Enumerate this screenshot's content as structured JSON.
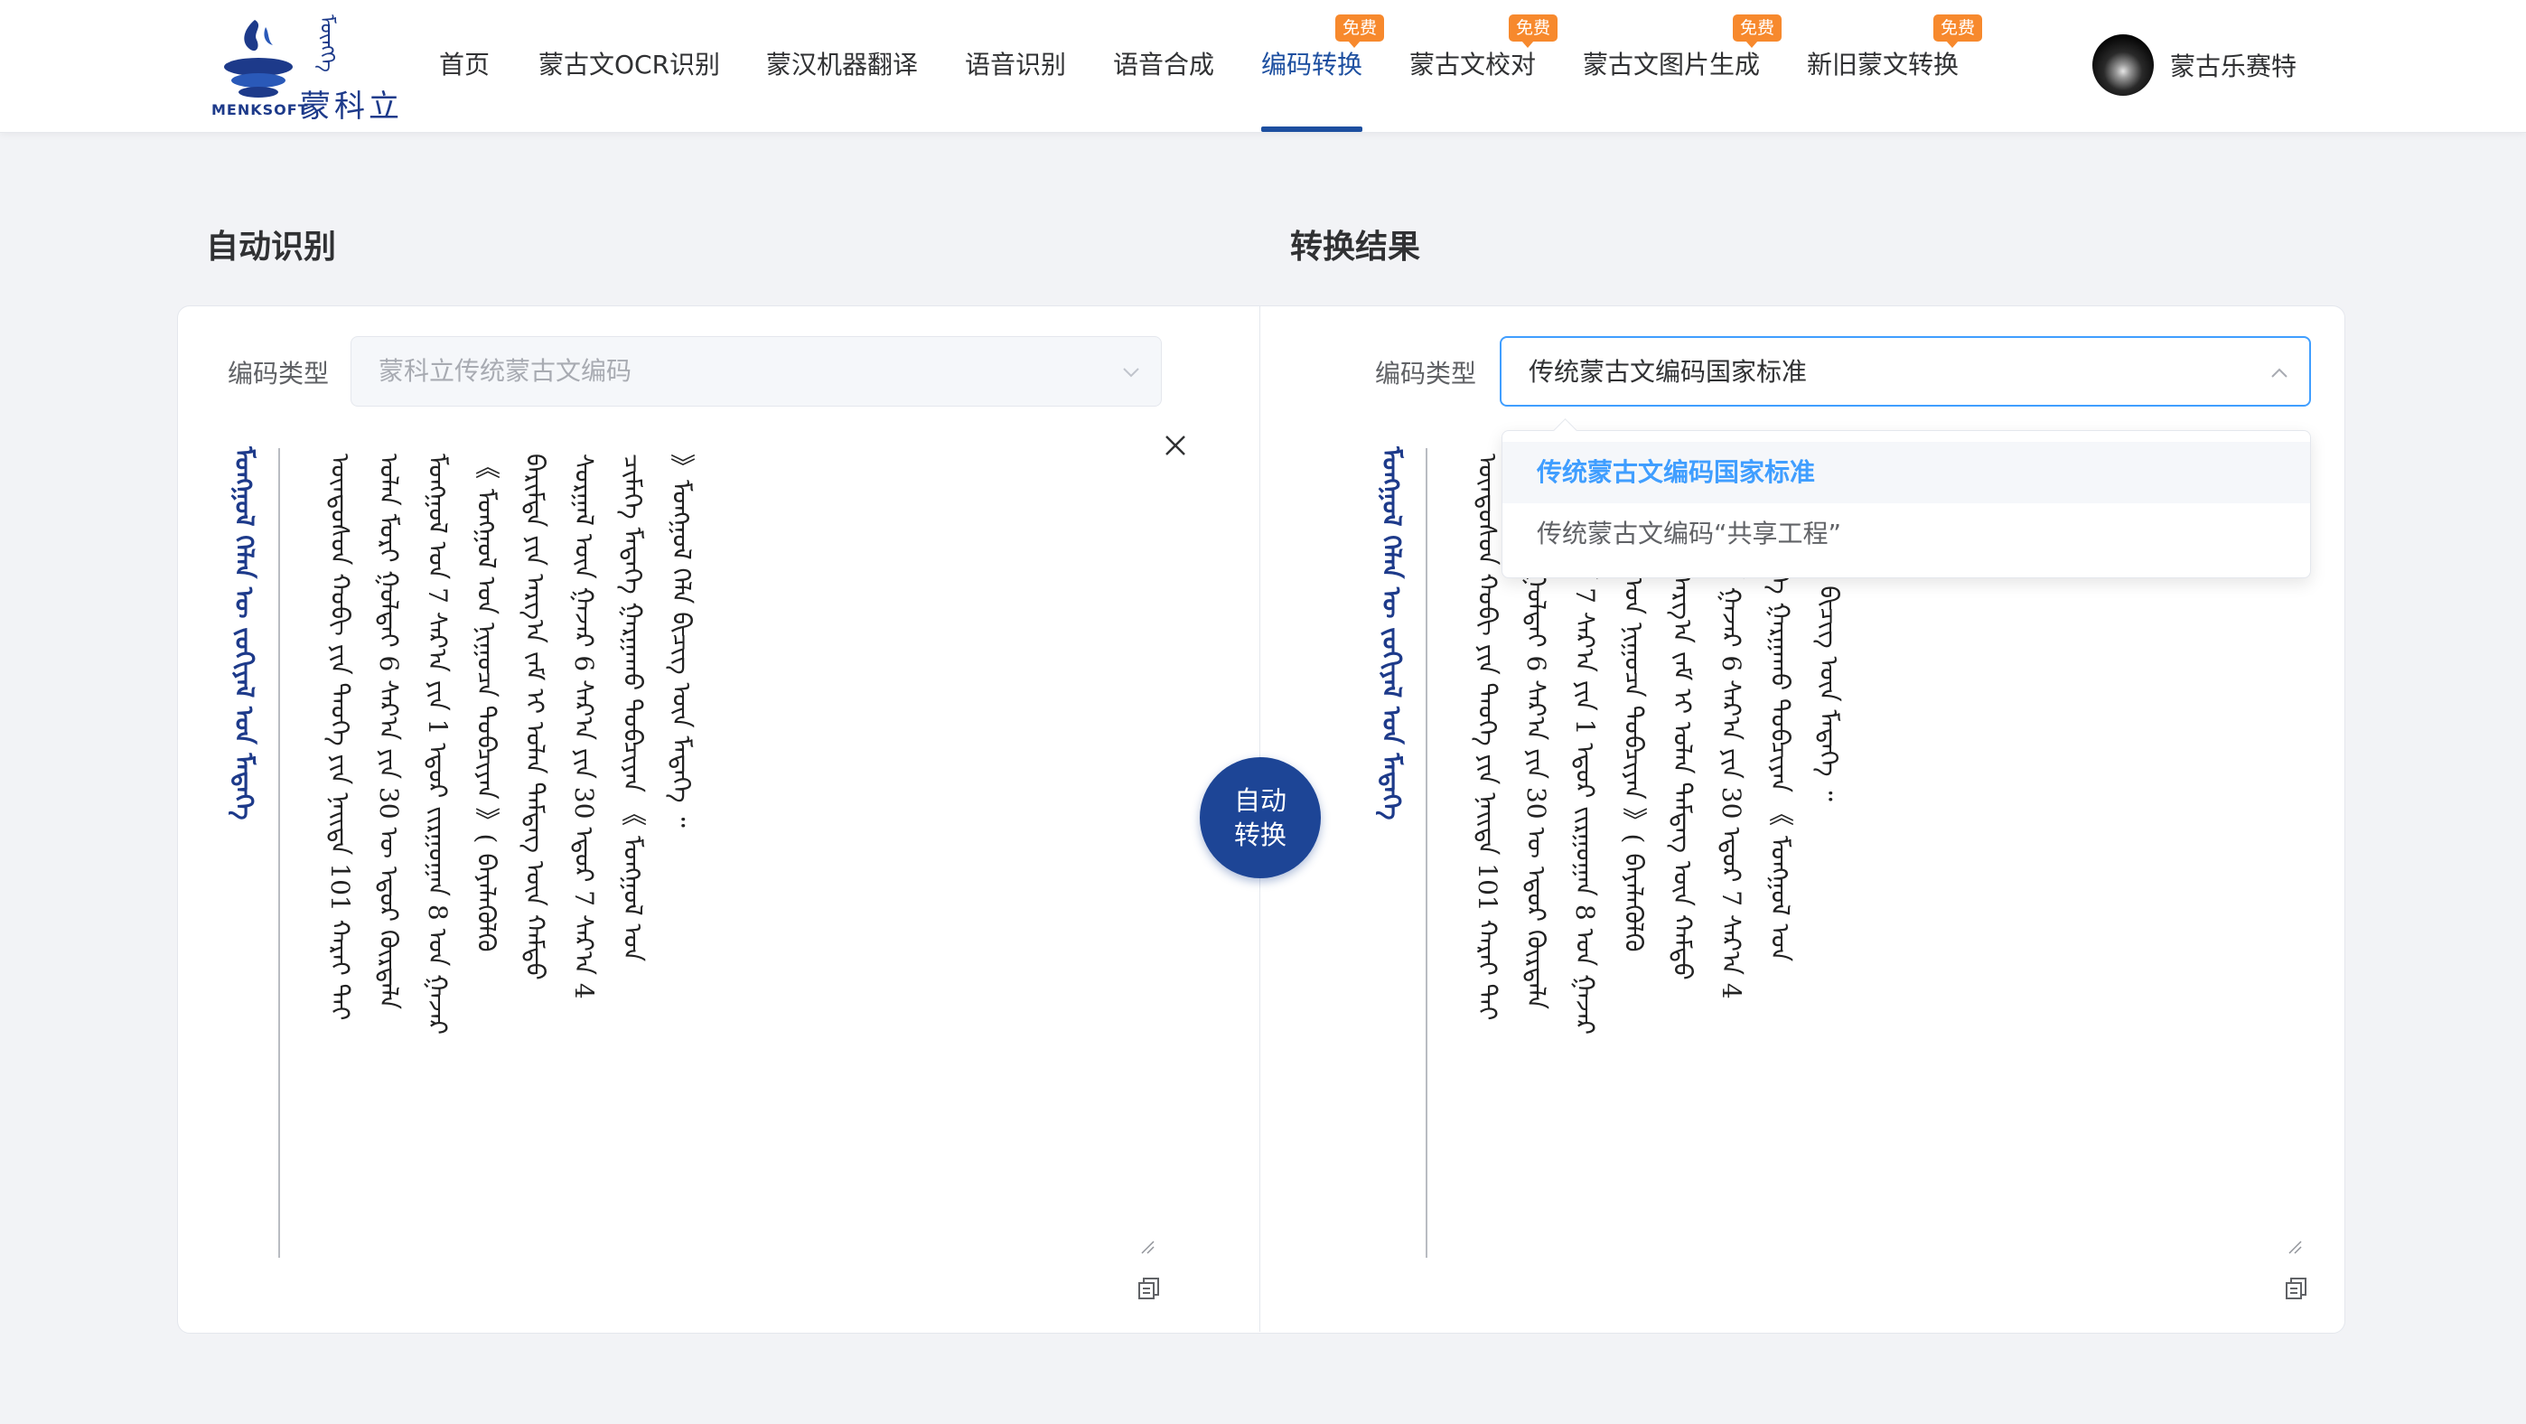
{
  "brand": {
    "name": "蒙科立",
    "sub": "MENKSOFT",
    "mongolian": "ᠮᠦᠩᠬᠡ"
  },
  "nav": {
    "items": [
      {
        "label": "首页",
        "badge": ""
      },
      {
        "label": "蒙古文OCR识别",
        "badge": ""
      },
      {
        "label": "蒙汉机器翻译",
        "badge": ""
      },
      {
        "label": "语音识别",
        "badge": ""
      },
      {
        "label": "语音合成",
        "badge": ""
      },
      {
        "label": "编码转换",
        "badge": "免费",
        "active": true
      },
      {
        "label": "蒙古文校对",
        "badge": "免费"
      },
      {
        "label": "蒙古文图片生成",
        "badge": "免费"
      },
      {
        "label": "新旧蒙文转换",
        "badge": "免费"
      }
    ],
    "user_name": "蒙古乐赛特"
  },
  "left": {
    "title": "自动识别",
    "field_label": "编码类型",
    "select_value": "蒙科立传统蒙古文编码",
    "heading_line": "ᠮᠣᠩᠭᠣᠯ ᠬᠡᠯᠡᠨ ᠦ ᠵᠣᠬᠢᠶᠠᠯ ᠤᠨ ᠮᠡᠳᠡᠭᠡ",
    "lines": [
      "ᠦᠨᠳᠦᠰᠦᠨ ᠬᠤᠪᠢ ᠶᠢᠨ ᠲᠡᠦᠬᠡ ᠶᠢᠨ ᠨᠡᠢᠲᠡ 101 ᠬᠠᠷᠠᠢ ᠲᠠᠢ",
      "ᠣᠯᠠᠨ ᠮᠣᠷᠢ ᠭᠣᠯᠲᠠᠢ 6 ᠰᠠᠷ᠎ᠠ ᠶᠢᠨ 30 ᠦ ᠡᠳᠦᠷ ᠬᠦᠷᠲᠡᠯᠡ",
      "ᠮᠣᠩᠭᠣᠯ ᠤᠨ 7 ᠰᠠᠷ᠎ᠠ ᠶᠢᠨ 1 ᠡᠳᠦᠷ ᠵᠢᠷᠭᠤᠭᠠᠨ 8 ᠤᠨ ᠭᠠᠵᠠᠷ",
      "《 ᠮᠣᠩᠭᠣᠯ ᠤᠨ ᠨᠢᠭᠤᠴᠠ ᠲᠣᠪᠴᠢᠶᠠᠨ 》( ᠪᠡᠶᠡᠯᠡᠭᠦᠯᠬᠦ",
      "ᠪᠠᠷᠢᠮᠲᠠ ᠶᠢᠨ ᠠᠷᠭ᠎ᠠ ᠵᠠᠮ ᠢ ᠣᠯᠠᠨ ᠲᠡᠮᠳᠡᠭ ᠦᠨ ᠬᠠᠮᠲᠤ",
      "ᠰᠤᠷᠭᠠᠯ ᠦᠨ ᠭᠠᠵᠠᠷ 6 ᠰᠠᠷ᠎ᠠ ᠶᠢᠨ 30 ᠡᠳᠦᠷ 7 ᠰᠠᠷ᠎ᠠ 4",
      "ᠴᠢᠮᠡᠭᠡ ᠮᠡᠳᠡᠭᠡ ᠭᠠᠷᠭᠠᠬᠤ ᠲᠣᠪᠴᠢᠶᠠᠨ 《 ᠮᠣᠩᠭᠣᠯ ᠤᠨ",
      "》ᠮᠣᠩᠭᠣᠯ ᠬᠡᠯᠡ ᠪᠢᠴᠢᠭ ᠦᠨ ᠮᠡᠳᠡᠭᠡ ᠃"
    ]
  },
  "right": {
    "title": "转换结果",
    "field_label": "编码类型",
    "select_value": "传统蒙古文编码国家标准",
    "dropdown_options": [
      {
        "label": "传统蒙古文编码国家标准",
        "selected": true
      },
      {
        "label": "传统蒙古文编码“共享工程”",
        "selected": false
      }
    ],
    "heading_line": "ᠮᠣᠩᠭᠣᠯ ᠬᠡᠯᠡᠨ ᠦ ᠵᠣᠬᠢᠶᠠᠯ ᠤᠨ ᠮᠡᠳᠡᠭᠡ",
    "lines": [
      "ᠦᠨᠳᠦᠰᠦᠨ ᠬᠤᠪᠢ ᠶᠢᠨ ᠲᠡᠦᠬᠡ ᠶᠢᠨ ᠨᠡᠢᠲᠡ 101 ᠬᠠᠷᠠᠢ ᠲᠠᠢ",
      "ᠣᠯᠠᠨ ᠮᠣᠷᠢ ᠭᠣᠯᠲᠠᠢ 6 ᠰᠠᠷ᠎ᠠ ᠶᠢᠨ 30 ᠦ ᠡᠳᠦᠷ ᠬᠦᠷᠲᠡᠯᠡ",
      "ᠮᠣᠩᠭᠣᠯ ᠤᠨ 7 ᠰᠠᠷ᠎ᠠ ᠶᠢᠨ 1 ᠡᠳᠦᠷ ᠵᠢᠷᠭᠤᠭᠠᠨ 8 ᠤᠨ ᠭᠠᠵᠠᠷ",
      "《 ᠮᠣᠩᠭᠣᠯ ᠤᠨ ᠨᠢᠭᠤᠴᠠ ᠲᠣᠪᠴᠢᠶᠠᠨ 》( ᠪᠡᠶᠡᠯᠡᠭᠦᠯᠬᠦ",
      "ᠪᠠᠷᠢᠮᠲᠠ ᠶᠢᠨ ᠠᠷᠭ᠎ᠠ ᠵᠠᠮ ᠢ ᠣᠯᠠᠨ ᠲᠡᠮᠳᠡᠭ ᠦᠨ ᠬᠠᠮᠲᠤ",
      "ᠰᠤᠷᠭᠠᠯ ᠦᠨ ᠭᠠᠵᠠᠷ 6 ᠰᠠᠷ᠎ᠠ ᠶᠢᠨ 30 ᠡᠳᠦᠷ 7 ᠰᠠᠷ᠎ᠠ 4",
      "ᠴᠢᠮᠡᠭᠡ ᠮᠡᠳᠡᠭᠡ ᠭᠠᠷᠭᠠᠬᠤ ᠲᠣᠪᠴᠢᠶᠠᠨ 《 ᠮᠣᠩᠭᠣᠯ ᠤᠨ",
      "ᠮᠣᠩᠭᠣᠯ ᠬᠡᠯᠡ ᠪᠢᠴᠢᠭ ᠦᠨ ᠮᠡᠳᠡᠭᠡ ᠃"
    ]
  },
  "convert_button": {
    "line1": "自动",
    "line2": "转换"
  },
  "colors": {
    "brand_blue": "#1d4596",
    "accent": "#409eff",
    "badge_orange": "#f7892d",
    "background": "#f2f3f6"
  },
  "icons": [
    "close-icon",
    "copy-icon",
    "chevron-down-icon",
    "chevron-up-icon",
    "resize-handle-icon"
  ]
}
